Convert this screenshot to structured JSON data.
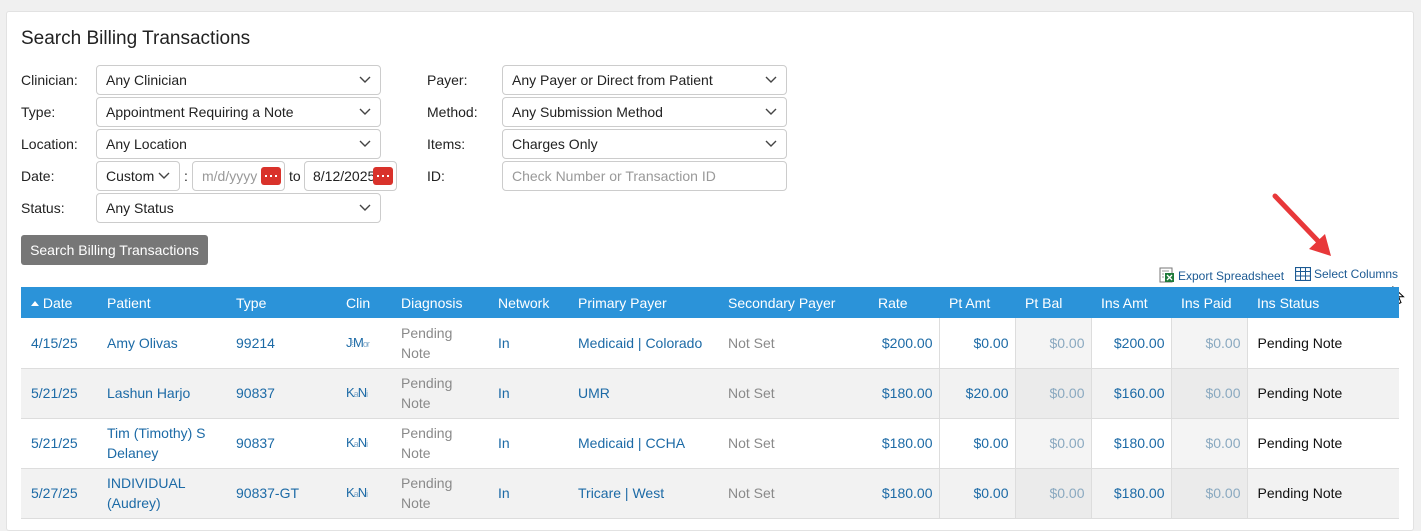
{
  "title": "Search Billing Transactions",
  "filters": {
    "clinician_label": "Clinician:",
    "clinician_value": "Any Clinician",
    "type_label": "Type:",
    "type_value": "Appointment Requiring a Note",
    "location_label": "Location:",
    "location_value": "Any Location",
    "date_label": "Date:",
    "date_mode": "Custom",
    "date_sep": ":",
    "date_from_placeholder": "m/d/yyyy",
    "date_to_word": "to",
    "date_to_value": "8/12/2025",
    "status_label": "Status:",
    "status_value": "Any Status",
    "payer_label": "Payer:",
    "payer_value": "Any Payer or Direct from Patient",
    "method_label": "Method:",
    "method_value": "Any Submission Method",
    "items_label": "Items:",
    "items_value": "Charges Only",
    "id_label": "ID:",
    "id_placeholder": "Check Number or Transaction ID"
  },
  "search_button": "Search Billing Transactions",
  "toolbar": {
    "export": "Export Spreadsheet",
    "select_columns": "Select Columns"
  },
  "colors": {
    "header": "#2b93d9",
    "link": "#1c6aa6",
    "excel": "#1f7a3a",
    "arrow": "#e8383a"
  },
  "table": {
    "sort_icon": "sort-asc-icon",
    "headers": [
      "Date",
      "Patient",
      "Type",
      "Clin",
      "Diagnosis",
      "Network",
      "Primary Payer",
      "Secondary Payer",
      "Rate",
      "Pt Amt",
      "Pt Bal",
      "Ins Amt",
      "Ins Paid",
      "Ins Status"
    ],
    "rows": [
      {
        "date": "4/15/25",
        "patient_1": "Amy Olivas",
        "patient_2": "",
        "type": "99214",
        "clin_a": "J",
        "clin_b": "M",
        "clin_c": "or",
        "diag_1": "Pending",
        "diag_2": "Note",
        "network": "In",
        "primary": "Medicaid | Colorado",
        "secondary": "Not Set",
        "rate": "$200.00",
        "pt_amt": "$0.00",
        "pt_bal": "$0.00",
        "ins_amt": "$200.00",
        "ins_paid": "$0.00",
        "ins_status": "Pending Note"
      },
      {
        "date": "5/21/25",
        "patient_1": "Lashun Harjo",
        "patient_2": "",
        "type": "90837",
        "clin_a": "K",
        "clin_b": "N",
        "clin_c": "",
        "diag_1": "Pending",
        "diag_2": "Note",
        "network": "In",
        "primary": "UMR",
        "secondary": "Not Set",
        "rate": "$180.00",
        "pt_amt": "$20.00",
        "pt_bal": "$0.00",
        "ins_amt": "$160.00",
        "ins_paid": "$0.00",
        "ins_status": "Pending Note"
      },
      {
        "date": "5/21/25",
        "patient_1": "Tim (Timothy) S",
        "patient_2": "Delaney",
        "type": "90837",
        "clin_a": "K",
        "clin_b": "N",
        "clin_c": "",
        "diag_1": "Pending",
        "diag_2": "Note",
        "network": "In",
        "primary": "Medicaid | CCHA",
        "secondary": "Not Set",
        "rate": "$180.00",
        "pt_amt": "$0.00",
        "pt_bal": "$0.00",
        "ins_amt": "$180.00",
        "ins_paid": "$0.00",
        "ins_status": "Pending Note"
      },
      {
        "date": "5/27/25",
        "patient_1": "INDIVIDUAL",
        "patient_2": "(Audrey)",
        "type": "90837-GT",
        "clin_a": "K",
        "clin_b": "N",
        "clin_c": "",
        "diag_1": "Pending",
        "diag_2": "Note",
        "network": "In",
        "primary": "Tricare | West",
        "secondary": "Not Set",
        "rate": "$180.00",
        "pt_amt": "$0.00",
        "pt_bal": "$0.00",
        "ins_amt": "$180.00",
        "ins_paid": "$0.00",
        "ins_status": "Pending Note"
      }
    ]
  }
}
